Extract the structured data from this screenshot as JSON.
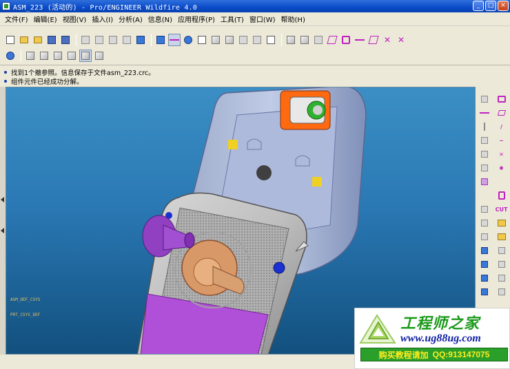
{
  "window": {
    "title": "ASM_223 (活动的) - Pro/ENGINEER Wildfire 4.0",
    "controls": {
      "minimize": "_",
      "maximize": "□",
      "close": "×"
    }
  },
  "menubar": {
    "items": [
      "文件(F)",
      "编辑(E)",
      "视图(V)",
      "插入(I)",
      "分析(A)",
      "信息(N)",
      "应用程序(P)",
      "工具(T)",
      "窗口(W)",
      "帮助(H)"
    ]
  },
  "toolbar1": {
    "icons": [
      "new-file",
      "open-folder",
      "open-folder-2",
      "save",
      "save-copy",
      "undo",
      "copy",
      "paste",
      "paste-special",
      "regenerate",
      "repaint",
      "spin-center",
      "zoom-in",
      "zoom-fit",
      "orient",
      "saved-views",
      "layers",
      "display-style",
      "close-window",
      "model-tree",
      "datum-plane",
      "datum-axis",
      "datum-point",
      "datum-csys",
      "sketch",
      "datum-curve",
      "point-cross",
      "analysis-cross"
    ],
    "pressed": "spin-center"
  },
  "toolbar2": {
    "icons": [
      "default-orient",
      "wireframe",
      "hidden-line",
      "no-hidden",
      "shading",
      "shading-edges"
    ],
    "pressed": "shading"
  },
  "messages": [
    "找到1个撤参照。信息保存于文件asm_223.crc。",
    "组件元件已经成功分解。"
  ],
  "right_toolbar": {
    "rows": [
      [
        "feature-icon",
        "sketch-icon"
      ],
      [
        "curve-icon",
        "plane-icon"
      ],
      [
        "axis-icon",
        "slash-icon"
      ],
      [
        "datum-icon",
        "wave-icon"
      ],
      [
        "point-icon",
        "cross-icon"
      ],
      [
        "grid-icon",
        "star-icon"
      ],
      [
        "box-icon",
        ""
      ],
      [
        "",
        "extrude-icon"
      ],
      [
        "arrow-icon",
        "cut-label"
      ],
      [
        "hole-icon",
        "shell-icon"
      ],
      [
        "rib-icon",
        "draft-icon"
      ],
      [
        "round-icon",
        "chamfer-icon"
      ],
      [
        "blend-icon",
        "sweep-icon"
      ],
      [
        "pattern-icon",
        "mirror-icon"
      ],
      [
        "merge-icon",
        "trim-icon"
      ]
    ],
    "cut_label": "CUT"
  },
  "viewport": {
    "labels": [
      "ASM_DEF_CSYS",
      "PRT_CSYS_DEF"
    ]
  },
  "watermark": {
    "title": "工程师之家",
    "url": "www.ug88ug.com",
    "buy": "购买教程请加",
    "qq": "QQ:913147075"
  },
  "colors": {
    "viewport_top": "#3b8fc4",
    "viewport_bottom": "#12507e",
    "accent_magenta": "#c020c0",
    "watermark_green": "#1a9a1a"
  }
}
